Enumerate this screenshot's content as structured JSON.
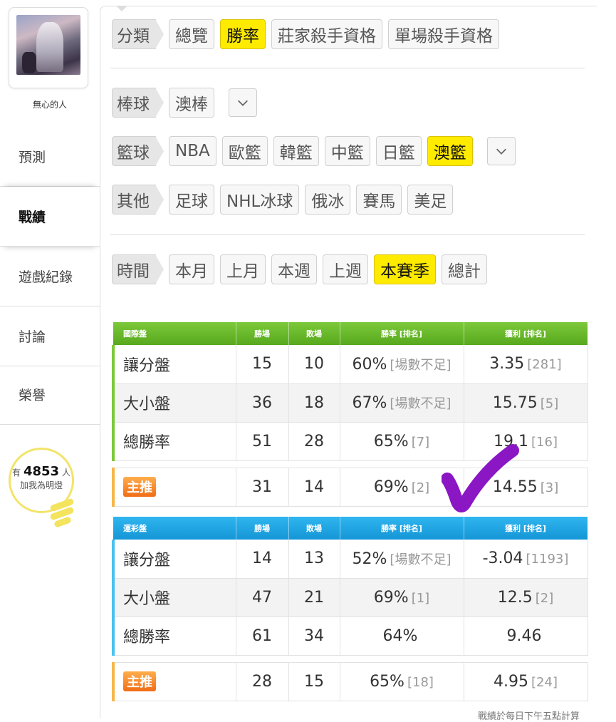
{
  "user": {
    "name": "無心的人"
  },
  "nav": [
    {
      "label": "預測",
      "active": false
    },
    {
      "label": "戰績",
      "active": true
    },
    {
      "label": "遊戲紀錄",
      "active": false
    },
    {
      "label": "討論",
      "active": false
    },
    {
      "label": "榮譽",
      "active": false
    }
  ],
  "fans": {
    "prefix": "有",
    "count": "4853",
    "suffix": "人",
    "line2": "加我為明燈"
  },
  "filters": {
    "type": {
      "label": "分類",
      "options": [
        "總覽",
        "勝率",
        "莊家殺手資格",
        "單場殺手資格"
      ],
      "selected": "勝率"
    },
    "baseball": {
      "label": "棒球",
      "options": [
        "澳棒"
      ]
    },
    "basketball": {
      "label": "籃球",
      "options": [
        "NBA",
        "歐籃",
        "韓籃",
        "中籃",
        "日籃",
        "澳籃"
      ],
      "selected": "澳籃"
    },
    "other": {
      "label": "其他",
      "options": [
        "足球",
        "NHL冰球",
        "俄冰",
        "賽馬",
        "美足"
      ]
    },
    "time": {
      "label": "時間",
      "options": [
        "本月",
        "上月",
        "本週",
        "上週",
        "本賽季",
        "總計"
      ],
      "selected": "本賽季"
    }
  },
  "icons": {
    "dropdown": "chevron-down-icon",
    "check": "check-mark"
  },
  "international": {
    "headers": [
      "國際盤",
      "勝場",
      "敗場",
      "勝率 [排名]",
      "獲利 [排名]"
    ],
    "rows": [
      {
        "name": "讓分盤",
        "win": "15",
        "loss": "10",
        "rate": "60%",
        "rate_rank": "[場數不足]",
        "profit": "3.35",
        "profit_rank": "[281]"
      },
      {
        "name": "大小盤",
        "win": "36",
        "loss": "18",
        "rate": "67%",
        "rate_rank": "[場數不足]",
        "profit": "15.75",
        "profit_rank": "[5]"
      },
      {
        "name": "總勝率",
        "win": "51",
        "loss": "28",
        "rate": "65%",
        "rate_rank": "[7]",
        "profit": "19.1",
        "profit_rank": "[16]"
      }
    ],
    "main": {
      "badge": "主推",
      "win": "31",
      "loss": "14",
      "rate": "69%",
      "rate_rank": "[2]",
      "profit": "14.55",
      "profit_rank": "[3]"
    }
  },
  "lottery": {
    "headers": [
      "運彩盤",
      "勝場",
      "敗場",
      "勝率 [排名]",
      "獲利 [排名]"
    ],
    "rows": [
      {
        "name": "讓分盤",
        "win": "14",
        "loss": "13",
        "rate": "52%",
        "rate_rank": "[場數不足]",
        "profit": "-3.04",
        "profit_rank": "[1193]"
      },
      {
        "name": "大小盤",
        "win": "47",
        "loss": "21",
        "rate": "69%",
        "rate_rank": "[1]",
        "profit": "12.5",
        "profit_rank": "[2]"
      },
      {
        "name": "總勝率",
        "win": "61",
        "loss": "34",
        "rate": "64%",
        "rate_rank": "",
        "profit": "9.46",
        "profit_rank": ""
      }
    ],
    "main": {
      "badge": "主推",
      "win": "28",
      "loss": "15",
      "rate": "65%",
      "rate_rank": "[18]",
      "profit": "4.95",
      "profit_rank": "[24]"
    }
  },
  "footer": {
    "note": "戰績於每日下午五點計算"
  },
  "colors": {
    "green": "#6fbf2f",
    "blue": "#1ea6e3",
    "highlight": "#ffeb00",
    "check": "#8a16c4"
  }
}
